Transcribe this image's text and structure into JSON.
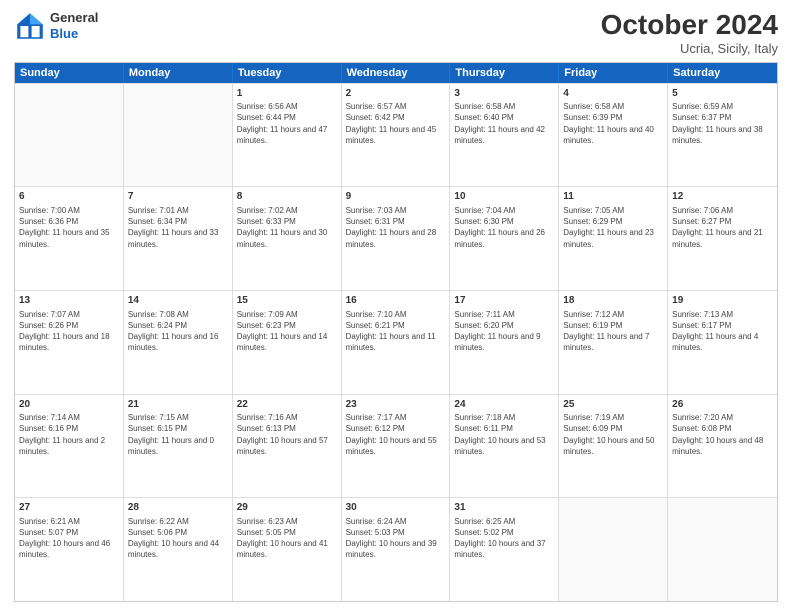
{
  "logo": {
    "general": "General",
    "blue": "Blue"
  },
  "header": {
    "month": "October 2024",
    "location": "Ucria, Sicily, Italy"
  },
  "days": [
    "Sunday",
    "Monday",
    "Tuesday",
    "Wednesday",
    "Thursday",
    "Friday",
    "Saturday"
  ],
  "rows": [
    [
      {
        "num": "",
        "text": ""
      },
      {
        "num": "",
        "text": ""
      },
      {
        "num": "1",
        "text": "Sunrise: 6:56 AM\nSunset: 6:44 PM\nDaylight: 11 hours and 47 minutes."
      },
      {
        "num": "2",
        "text": "Sunrise: 6:57 AM\nSunset: 6:42 PM\nDaylight: 11 hours and 45 minutes."
      },
      {
        "num": "3",
        "text": "Sunrise: 6:58 AM\nSunset: 6:40 PM\nDaylight: 11 hours and 42 minutes."
      },
      {
        "num": "4",
        "text": "Sunrise: 6:58 AM\nSunset: 6:39 PM\nDaylight: 11 hours and 40 minutes."
      },
      {
        "num": "5",
        "text": "Sunrise: 6:59 AM\nSunset: 6:37 PM\nDaylight: 11 hours and 38 minutes."
      }
    ],
    [
      {
        "num": "6",
        "text": "Sunrise: 7:00 AM\nSunset: 6:36 PM\nDaylight: 11 hours and 35 minutes."
      },
      {
        "num": "7",
        "text": "Sunrise: 7:01 AM\nSunset: 6:34 PM\nDaylight: 11 hours and 33 minutes."
      },
      {
        "num": "8",
        "text": "Sunrise: 7:02 AM\nSunset: 6:33 PM\nDaylight: 11 hours and 30 minutes."
      },
      {
        "num": "9",
        "text": "Sunrise: 7:03 AM\nSunset: 6:31 PM\nDaylight: 11 hours and 28 minutes."
      },
      {
        "num": "10",
        "text": "Sunrise: 7:04 AM\nSunset: 6:30 PM\nDaylight: 11 hours and 26 minutes."
      },
      {
        "num": "11",
        "text": "Sunrise: 7:05 AM\nSunset: 6:29 PM\nDaylight: 11 hours and 23 minutes."
      },
      {
        "num": "12",
        "text": "Sunrise: 7:06 AM\nSunset: 6:27 PM\nDaylight: 11 hours and 21 minutes."
      }
    ],
    [
      {
        "num": "13",
        "text": "Sunrise: 7:07 AM\nSunset: 6:26 PM\nDaylight: 11 hours and 18 minutes."
      },
      {
        "num": "14",
        "text": "Sunrise: 7:08 AM\nSunset: 6:24 PM\nDaylight: 11 hours and 16 minutes."
      },
      {
        "num": "15",
        "text": "Sunrise: 7:09 AM\nSunset: 6:23 PM\nDaylight: 11 hours and 14 minutes."
      },
      {
        "num": "16",
        "text": "Sunrise: 7:10 AM\nSunset: 6:21 PM\nDaylight: 11 hours and 11 minutes."
      },
      {
        "num": "17",
        "text": "Sunrise: 7:11 AM\nSunset: 6:20 PM\nDaylight: 11 hours and 9 minutes."
      },
      {
        "num": "18",
        "text": "Sunrise: 7:12 AM\nSunset: 6:19 PM\nDaylight: 11 hours and 7 minutes."
      },
      {
        "num": "19",
        "text": "Sunrise: 7:13 AM\nSunset: 6:17 PM\nDaylight: 11 hours and 4 minutes."
      }
    ],
    [
      {
        "num": "20",
        "text": "Sunrise: 7:14 AM\nSunset: 6:16 PM\nDaylight: 11 hours and 2 minutes."
      },
      {
        "num": "21",
        "text": "Sunrise: 7:15 AM\nSunset: 6:15 PM\nDaylight: 11 hours and 0 minutes."
      },
      {
        "num": "22",
        "text": "Sunrise: 7:16 AM\nSunset: 6:13 PM\nDaylight: 10 hours and 57 minutes."
      },
      {
        "num": "23",
        "text": "Sunrise: 7:17 AM\nSunset: 6:12 PM\nDaylight: 10 hours and 55 minutes."
      },
      {
        "num": "24",
        "text": "Sunrise: 7:18 AM\nSunset: 6:11 PM\nDaylight: 10 hours and 53 minutes."
      },
      {
        "num": "25",
        "text": "Sunrise: 7:19 AM\nSunset: 6:09 PM\nDaylight: 10 hours and 50 minutes."
      },
      {
        "num": "26",
        "text": "Sunrise: 7:20 AM\nSunset: 6:08 PM\nDaylight: 10 hours and 48 minutes."
      }
    ],
    [
      {
        "num": "27",
        "text": "Sunrise: 6:21 AM\nSunset: 5:07 PM\nDaylight: 10 hours and 46 minutes."
      },
      {
        "num": "28",
        "text": "Sunrise: 6:22 AM\nSunset: 5:06 PM\nDaylight: 10 hours and 44 minutes."
      },
      {
        "num": "29",
        "text": "Sunrise: 6:23 AM\nSunset: 5:05 PM\nDaylight: 10 hours and 41 minutes."
      },
      {
        "num": "30",
        "text": "Sunrise: 6:24 AM\nSunset: 5:03 PM\nDaylight: 10 hours and 39 minutes."
      },
      {
        "num": "31",
        "text": "Sunrise: 6:25 AM\nSunset: 5:02 PM\nDaylight: 10 hours and 37 minutes."
      },
      {
        "num": "",
        "text": ""
      },
      {
        "num": "",
        "text": ""
      }
    ]
  ]
}
